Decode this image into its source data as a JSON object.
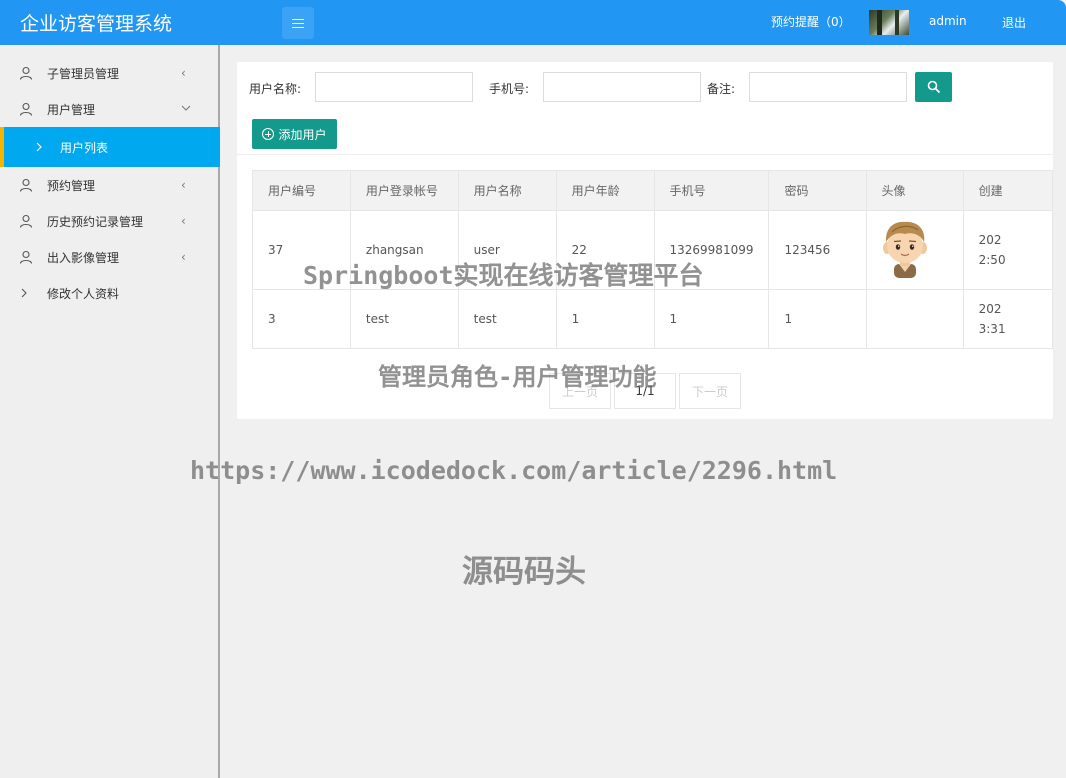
{
  "header": {
    "title": "企业访客管理系统",
    "reminder": "预约提醒（0）",
    "username": "admin",
    "logout": "退出"
  },
  "sidebar": {
    "items": [
      {
        "label": "子管理员管理",
        "icon": "user-icon",
        "chevron": "<"
      },
      {
        "label": "用户管理",
        "icon": "user-icon",
        "chevron": "expanded"
      },
      {
        "label": "用户列表",
        "icon": "chevron-right-icon",
        "active": true
      },
      {
        "label": "预约管理",
        "icon": "user-icon",
        "chevron": "<"
      },
      {
        "label": "历史预约记录管理",
        "icon": "user-icon",
        "chevron": "<"
      },
      {
        "label": "出入影像管理",
        "icon": "user-icon",
        "chevron": "<"
      },
      {
        "label": "修改个人资料",
        "icon": "chevron-right-icon"
      }
    ]
  },
  "filters": {
    "name_label": "用户名称:",
    "phone_label": "手机号:",
    "note_label": "备注:",
    "name_value": "",
    "phone_value": "",
    "note_value": ""
  },
  "actions": {
    "add_user": "添加用户",
    "search_icon": "search-icon"
  },
  "table": {
    "headers": [
      "用户编号",
      "用户登录帐号",
      "用户名称",
      "用户年龄",
      "手机号",
      "密码",
      "头像",
      "创建"
    ],
    "rows": [
      {
        "id": "37",
        "account": "zhangsan",
        "name": "user",
        "age": "22",
        "phone": "13269981099",
        "password": "123456",
        "avatar": "cartoon-boy-avatar",
        "created_line1": "202",
        "created_line2": "2:50"
      },
      {
        "id": "3",
        "account": "test",
        "name": "test",
        "age": "1",
        "phone": "1",
        "password": "1",
        "avatar": "",
        "created_line1": "202",
        "created_line2": "3:31"
      }
    ]
  },
  "pagination": {
    "prev": "上一页",
    "current": "1/1",
    "next": "下一页"
  },
  "watermarks": {
    "line1": "Springboot实现在线访客管理平台",
    "line2": "管理员角色-用户管理功能",
    "line3": "https://www.icodedock.com/article/2296.html",
    "line4": "源码码头"
  },
  "colors": {
    "header_bg": "#2196f3",
    "active_nav_bg": "#00a8f0",
    "active_nav_marker": "#f5b400",
    "primary_button": "#149a8c"
  }
}
